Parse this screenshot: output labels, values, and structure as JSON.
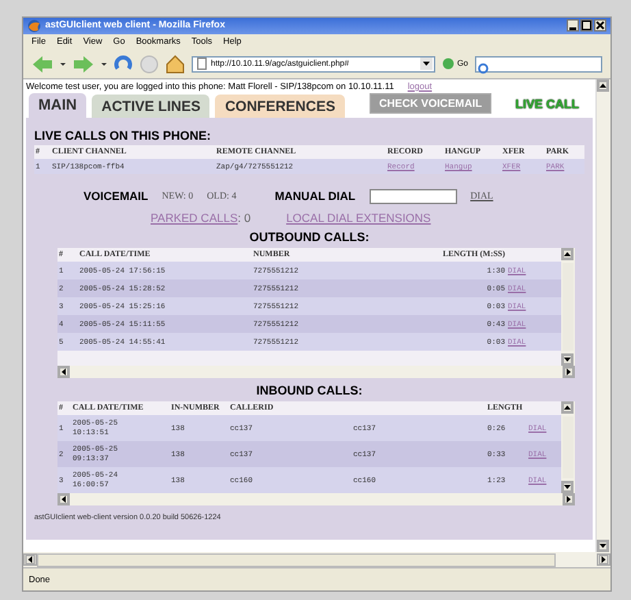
{
  "window": {
    "title": "astGUIclient web client - Mozilla Firefox"
  },
  "menu": [
    "File",
    "Edit",
    "View",
    "Go",
    "Bookmarks",
    "Tools",
    "Help"
  ],
  "toolbar": {
    "address": "http://10.10.11.9/agc/astguiclient.php#",
    "go": "Go"
  },
  "page": {
    "welcome": "Welcome test user, you are logged into this phone: Matt Florell - SIP/138pcom on 10.10.11.11",
    "logout": "logout",
    "tabs": [
      {
        "label": "MAIN",
        "selected": true,
        "color": "#d9d2e4"
      },
      {
        "label": "ACTIVE LINES",
        "selected": false,
        "color": "#d4dbcf"
      },
      {
        "label": "CONFERENCES",
        "selected": false,
        "color": "#f5dcc0"
      }
    ],
    "buttons": [
      {
        "label": "CHECK VOICEMAIL",
        "disabled": true
      },
      {
        "label": "LIVE CALL",
        "disabled": false
      }
    ],
    "live_calls": {
      "heading": "LIVE CALLS ON THIS PHONE:",
      "columns": [
        "#",
        "CLIENT CHANNEL",
        "REMOTE CHANNEL",
        "RECORD",
        "HANGUP",
        "XFER",
        "PARK"
      ],
      "rows": [
        {
          "cells": [
            "1",
            "SIP/138pcom-ffb4",
            "Zap/g4/7275551212"
          ],
          "links": [
            "Record",
            "Hangup",
            "XFER",
            "PARK"
          ]
        }
      ]
    },
    "voicemail": {
      "label": "VOICEMAIL",
      "new": "NEW: 0",
      "old": "OLD: 4"
    },
    "manual_dial": {
      "label": "MANUAL DIAL",
      "link": "DIAL"
    },
    "parked": {
      "link": "PARKED CALLS",
      "count": ": 0"
    },
    "local_dial": "LOCAL DIAL EXTENSIONS",
    "outbound": {
      "heading": "OUTBOUND CALLS:",
      "columns": [
        "#",
        "CALL DATE/TIME",
        "NUMBER",
        "LENGTH (M:SS)"
      ],
      "rows": [
        {
          "cells": [
            "1",
            "2005-05-24 17:56:15",
            "7275551212",
            "1:30"
          ],
          "link": "DIAL"
        },
        {
          "cells": [
            "2",
            "2005-05-24 15:28:52",
            "7275551212",
            "0:05"
          ],
          "link": "DIAL"
        },
        {
          "cells": [
            "3",
            "2005-05-24 15:25:16",
            "7275551212",
            "0:03"
          ],
          "link": "DIAL"
        },
        {
          "cells": [
            "4",
            "2005-05-24 15:11:55",
            "7275551212",
            "0:43"
          ],
          "link": "DIAL"
        },
        {
          "cells": [
            "5",
            "2005-05-24 14:55:41",
            "7275551212",
            "0:03"
          ],
          "link": "DIAL"
        }
      ]
    },
    "inbound": {
      "heading": "INBOUND CALLS:",
      "columns": [
        "#",
        "CALL DATE/TIME",
        "IN-NUMBER",
        "CALLERID",
        "",
        "LENGTH"
      ],
      "rows": [
        {
          "cells": [
            "1",
            "2005-05-25 10:13:51",
            "138",
            "cc137",
            "cc137",
            "0:26"
          ],
          "link": "DIAL"
        },
        {
          "cells": [
            "2",
            "2005-05-25 09:13:37",
            "138",
            "cc137",
            "cc137",
            "0:33"
          ],
          "link": "DIAL"
        },
        {
          "cells": [
            "3",
            "2005-05-24 16:00:57",
            "138",
            "cc160",
            "cc160",
            "1:23"
          ],
          "link": "DIAL"
        }
      ]
    },
    "version": "astGUIclient web-client version 0.0.20 build 50626-1224"
  },
  "status_bar": "Done"
}
